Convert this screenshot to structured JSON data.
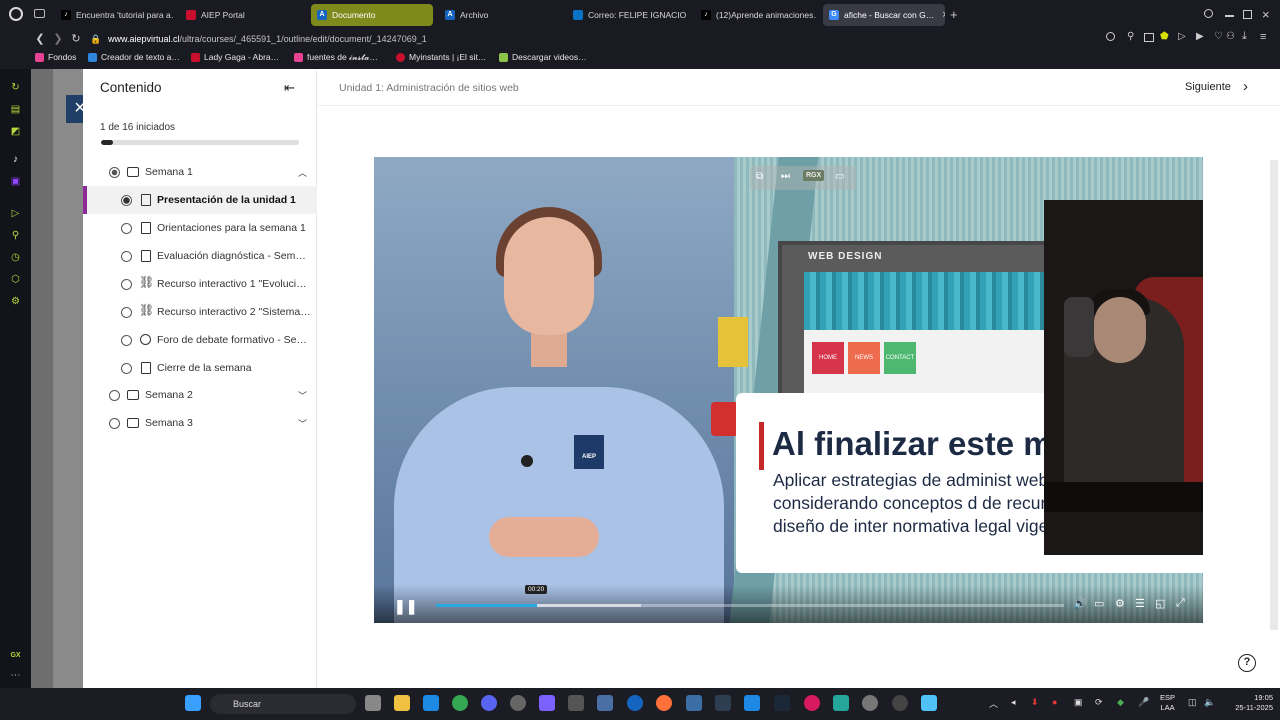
{
  "browser": {
    "tabs": [
      {
        "label": "Encuentra 'tutorial para a…",
        "color": "#1f1f1f"
      },
      {
        "label": "AIEP Portal",
        "color": "#c8102e"
      },
      {
        "label": "Documento",
        "color": "#1565c0",
        "active": true
      },
      {
        "label": "Archivo",
        "color": "#1565c0"
      },
      {
        "label": "Correo: FELIPE IGNACIO …",
        "color": "#0b73c5"
      },
      {
        "label": "(12)Aprende animaciones…",
        "color": "#1f1f1f"
      },
      {
        "label": "afiche - Buscar con G…",
        "color": "#3d8bfd",
        "active": true
      }
    ],
    "url_domain": "www.aiepvirtual.cl",
    "url_path": "/ultra/courses/_465591_1/outline/edit/document/_14247069_1",
    "bookmarks": [
      {
        "label": "Fondos",
        "color": "#e84393"
      },
      {
        "label": "Creador de texto a…",
        "color": "#2e86de"
      },
      {
        "label": "Lady Gaga - Abra…",
        "color": "#c8102e"
      },
      {
        "label": "fuentes de 𝓲𝓷𝓼𝓽𝓪…",
        "color": "#e84393"
      },
      {
        "label": "Myinstants | ¡El sit…",
        "color": "#c8102e"
      },
      {
        "label": "Descargar videos…",
        "color": "#8bc34a"
      }
    ],
    "tab_x": "×",
    "new_tab": "+"
  },
  "panel": {
    "title": "Contenido",
    "progress_text": "1 de 16 iniciados",
    "progress_fraction": 0.0625,
    "weeks": [
      {
        "label": "Semana 1",
        "expanded": true
      },
      {
        "label": "Semana 2",
        "expanded": false
      },
      {
        "label": "Semana 3",
        "expanded": false
      }
    ],
    "items": [
      {
        "label": "Presentación de la unidad 1",
        "icon": "document-icon",
        "selected": true
      },
      {
        "label": "Orientaciones para la semana 1",
        "icon": "document-icon"
      },
      {
        "label": "Evaluación diagnóstica - Sema…",
        "icon": "page-icon"
      },
      {
        "label": "Recurso interactivo 1 \"Evoluci…",
        "icon": "link-icon"
      },
      {
        "label": "Recurso interactivo 2 \"Sistema…",
        "icon": "link-icon"
      },
      {
        "label": "Foro de debate formativo - Se…",
        "icon": "chat-icon"
      },
      {
        "label": "Cierre de la semana",
        "icon": "document-icon"
      }
    ]
  },
  "content": {
    "breadcrumb": "Unidad 1: Administración de sitios web",
    "next_label": "Siguiente"
  },
  "video": {
    "monitor_title": "WEB DESIGN",
    "web_buttons": [
      "HOME",
      "NEWS",
      "CONTACT"
    ],
    "badge_text": "AIEP",
    "card_title": "Al finalizar este mó",
    "card_body": "Aplicar estrategias de administ web, considerando conceptos d de recursos del diseño de inter normativa legal vigente.",
    "toolbar_rgx": "RGX",
    "time_tooltip": "00:20",
    "progress_fraction": 0.16
  },
  "taskbar": {
    "search_placeholder": "Buscar",
    "lang_line1": "ESP",
    "lang_line2": "LAA",
    "time": "19:05",
    "date": "25-11-2025"
  }
}
